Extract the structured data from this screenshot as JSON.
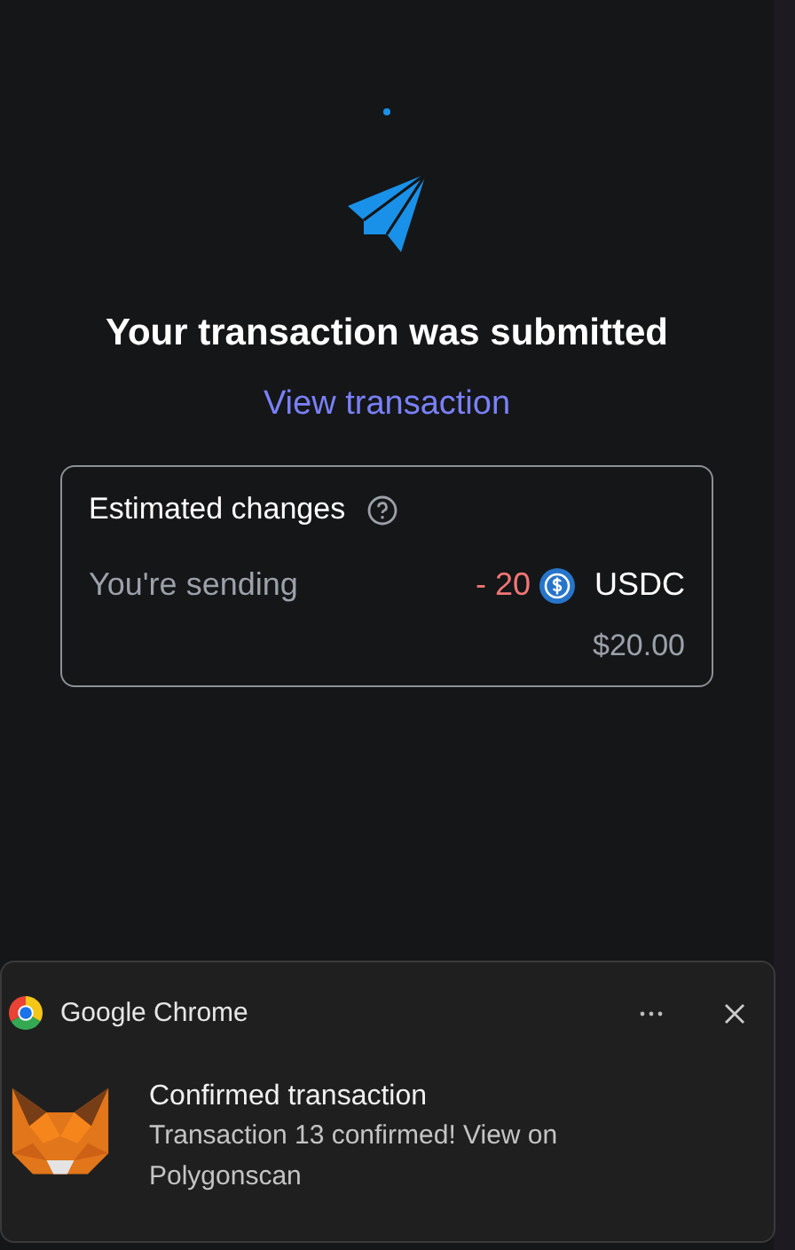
{
  "heading": "Your transaction was submitted",
  "link": "View transaction",
  "changes": {
    "title": "Estimated changes",
    "rows": [
      {
        "label": "You're sending",
        "amount": "- 20",
        "token": "USDC",
        "fiat": "$20.00"
      }
    ]
  },
  "notification": {
    "app": "Google Chrome",
    "title": "Confirmed transaction",
    "message": "Transaction 13 confirmed! View on Polygonscan"
  }
}
